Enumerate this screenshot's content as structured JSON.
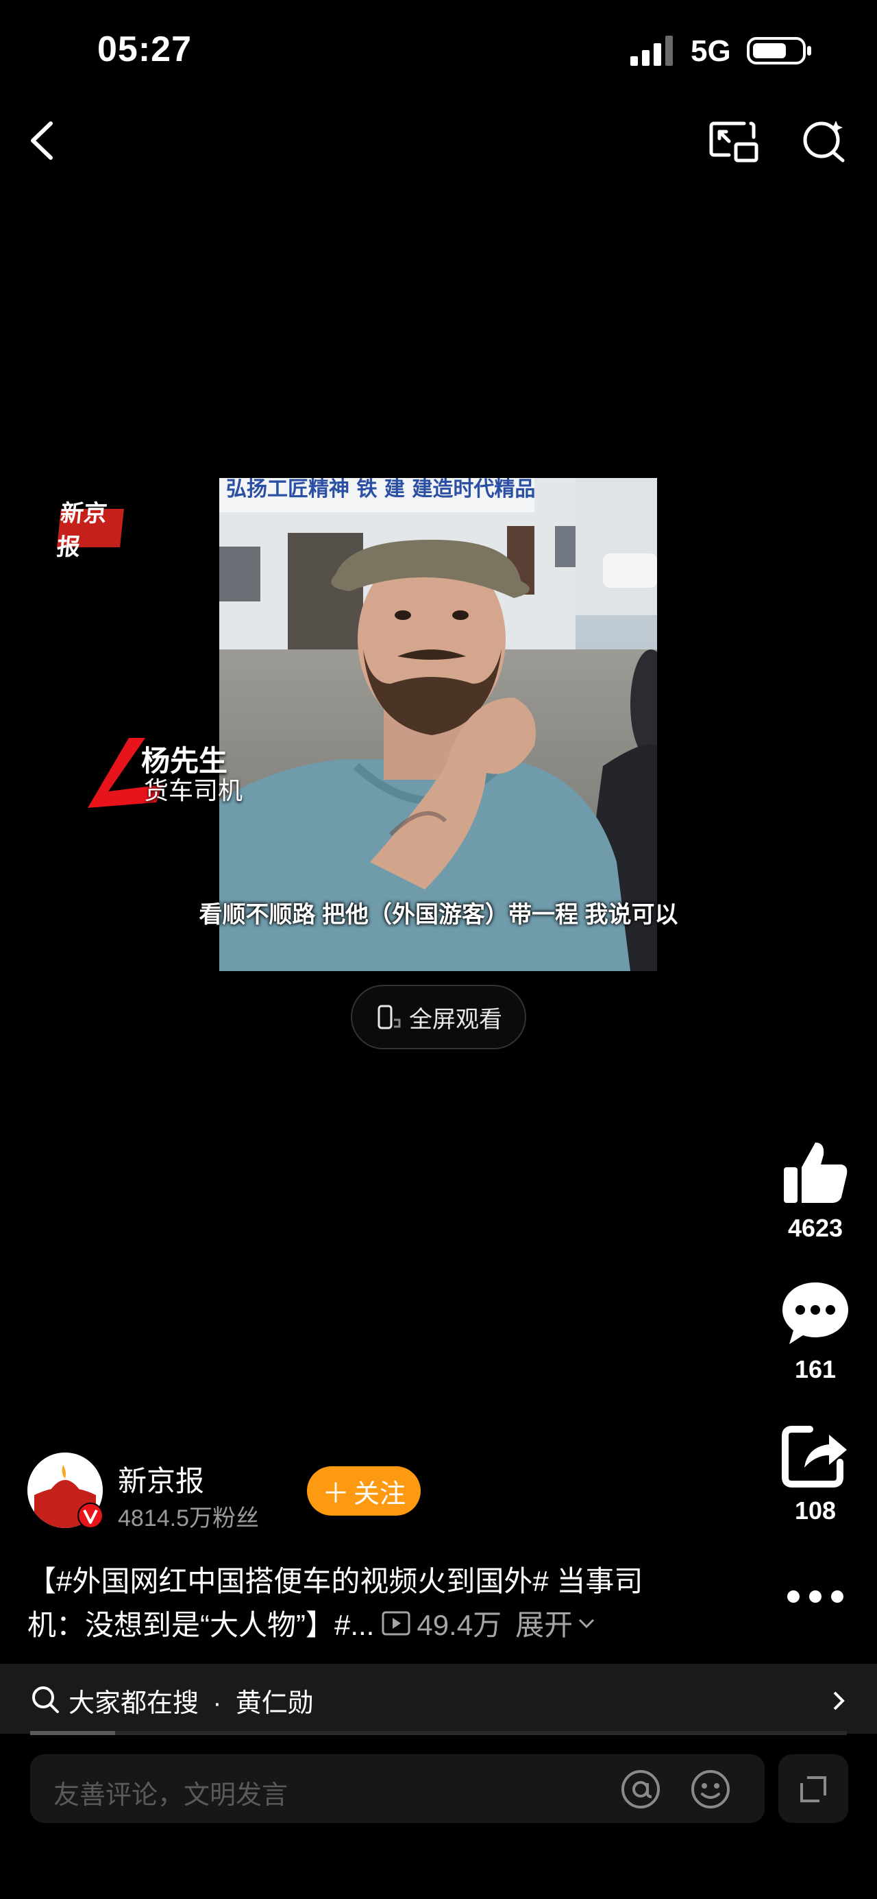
{
  "status_bar": {
    "time": "05:27",
    "network": "5G",
    "battery_level": 0.7
  },
  "video": {
    "logo_text": "新京报",
    "lower_third": {
      "name": "杨先生",
      "role": "货车司机"
    },
    "subtitle": "看顺不顺路 把他（外国游客）带一程 我说可以",
    "banner_text": "弘扬工匠精神 铁 建 建造时代精品"
  },
  "fullscreen_label": "全屏观看",
  "rail": {
    "likes": "4623",
    "comments": "161",
    "shares": "108"
  },
  "author": {
    "name": "新京报",
    "followers": "4814.5万粉丝",
    "follow_label": "关注"
  },
  "description": {
    "line1": "【#外国网红中国搭便车的视频火到国外# 当事司",
    "line2": "机：没想到是“大人物”】#...",
    "plays": "49.4万",
    "expand_label": "展开"
  },
  "hot_search": {
    "prefix": "大家都在搜",
    "dot": "·",
    "term": "黄仁勋"
  },
  "comment_input": {
    "placeholder": "友善评论，文明发言"
  },
  "icons": [
    "back-icon",
    "pip-icon",
    "search-icon",
    "like-icon",
    "comment-icon",
    "share-icon",
    "more-icon",
    "at-icon",
    "emoji-icon",
    "expand-icon",
    "play-count-icon",
    "chevron-right-icon"
  ],
  "colors": {
    "follow": "#fe9a12",
    "logo_red": "#c6201b",
    "background": "#000000"
  }
}
